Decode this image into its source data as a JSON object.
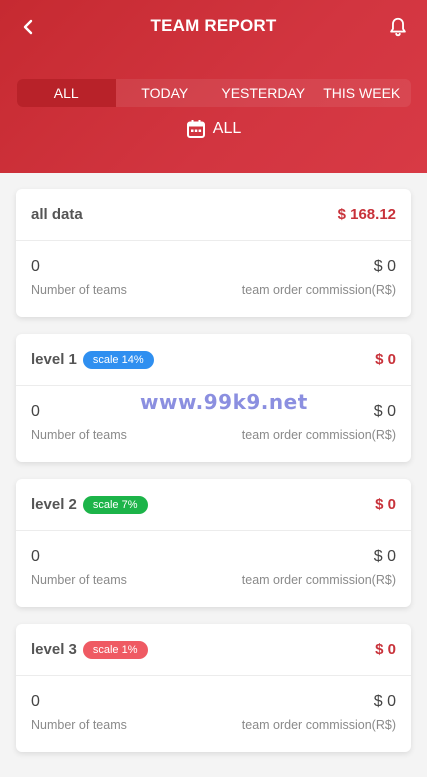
{
  "header": {
    "title": "TEAM REPORT",
    "back_icon": "chevron-left-icon",
    "notify_icon": "bell-icon",
    "bg_color": "#d23540"
  },
  "tabs": [
    {
      "label": "ALL",
      "active": true
    },
    {
      "label": "TODAY",
      "active": false
    },
    {
      "label": "YESTERDAY",
      "active": false
    },
    {
      "label": "THIS WEEK",
      "active": false
    }
  ],
  "date_filter": {
    "icon": "calendar-icon",
    "label": "ALL"
  },
  "cards": [
    {
      "title": "all data",
      "badge": null,
      "amount": "$ 168.12",
      "teams_value": "0",
      "teams_label": "Number of teams",
      "commission_value": "$ 0",
      "commission_label": "team order commission(R$)"
    },
    {
      "title": "level 1",
      "badge": {
        "text": "scale 14%",
        "color": "#2f8ff0"
      },
      "amount": "$ 0",
      "teams_value": "0",
      "teams_label": "Number of teams",
      "commission_value": "$ 0",
      "commission_label": "team order commission(R$)"
    },
    {
      "title": "level 2",
      "badge": {
        "text": "scale 7%",
        "color": "#1cb449"
      },
      "amount": "$ 0",
      "teams_value": "0",
      "teams_label": "Number of teams",
      "commission_value": "$ 0",
      "commission_label": "team order commission(R$)"
    },
    {
      "title": "level 3",
      "badge": {
        "text": "scale 1%",
        "color": "#ef5a63"
      },
      "amount": "$ 0",
      "teams_value": "0",
      "teams_label": "Number of teams",
      "commission_value": "$ 0",
      "commission_label": "team order commission(R$)"
    }
  ],
  "watermark": "www.99k9.net"
}
